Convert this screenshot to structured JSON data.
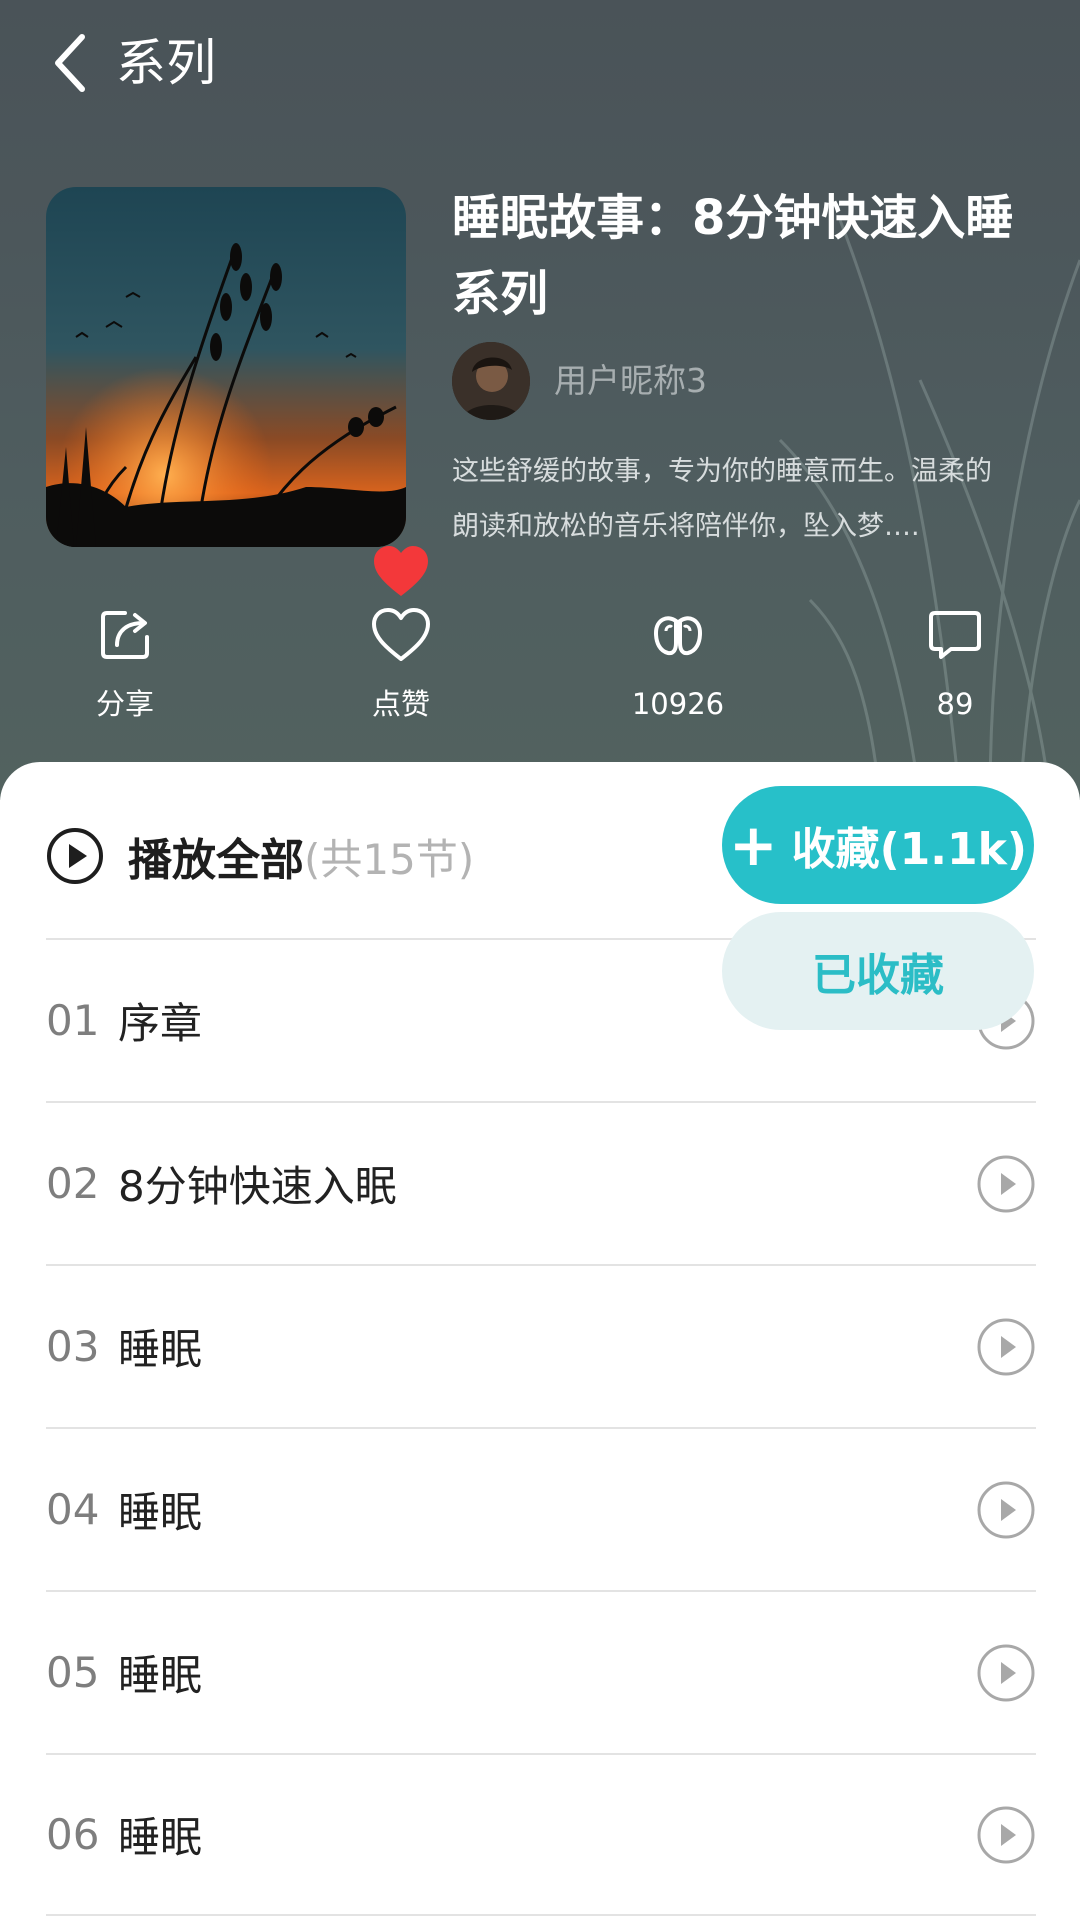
{
  "nav": {
    "title": "系列"
  },
  "series": {
    "title": "睡眠故事：8分钟快速入睡系列",
    "author": "用户昵称3",
    "description": "这些舒缓的故事，专为你的睡意而生。温柔的朗读和放松的音乐将陪伴你，坠入梦…."
  },
  "actions": {
    "share": "分享",
    "like": "点赞",
    "listens": "10926",
    "comments": "89"
  },
  "playlist": {
    "play_all": "播放全部",
    "count": "(共15节)",
    "favorite_label": "收藏(1.1k)",
    "favorited_label": "已收藏"
  },
  "tracks": [
    {
      "num": "01",
      "name": "序章"
    },
    {
      "num": "02",
      "name": "8分钟快速入眠"
    },
    {
      "num": "03",
      "name": "睡眠"
    },
    {
      "num": "04",
      "name": "睡眠"
    },
    {
      "num": "05",
      "name": "睡眠"
    },
    {
      "num": "06",
      "name": "睡眠"
    }
  ],
  "colors": {
    "accent": "#27c0c9",
    "like": "#f3383a",
    "header_bg": "#4c575b"
  },
  "icons": {
    "back": "chevron-left-icon",
    "share": "share-icon",
    "like": "heart-icon",
    "listens": "ear-icon",
    "comments": "comment-icon",
    "play": "play-circle-icon"
  }
}
